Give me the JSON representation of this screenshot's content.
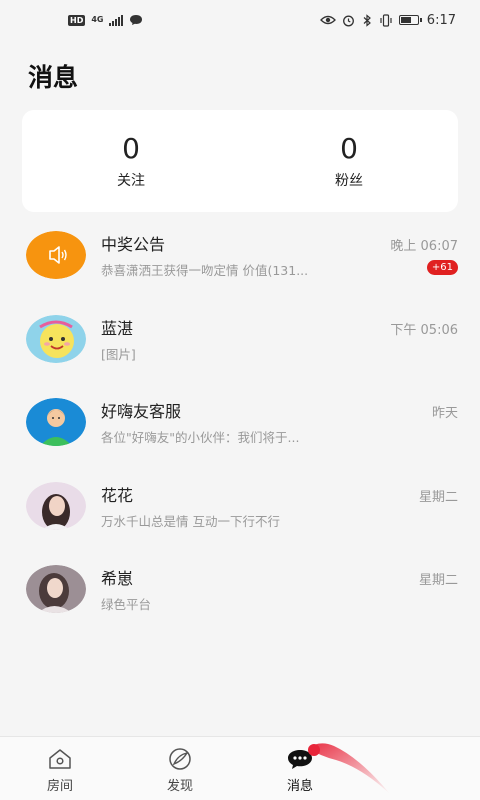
{
  "status_bar": {
    "hd": "HD",
    "network": "4G",
    "time": "6:17",
    "icons": [
      "hd-badge-icon",
      "signal-icon",
      "chat-bubble-icon",
      "eye-icon",
      "alarm-icon",
      "bluetooth-icon",
      "vibrate-icon",
      "battery-icon"
    ]
  },
  "header": {
    "title": "消息"
  },
  "stats": [
    {
      "value": "0",
      "label": "关注"
    },
    {
      "value": "0",
      "label": "粉丝"
    }
  ],
  "conversations": [
    {
      "name": "中奖公告",
      "preview": "恭喜潇洒王获得一吻定情 价值(131...",
      "time": "晚上 06:07",
      "badge": "+61",
      "avatar": "speaker-icon"
    },
    {
      "name": "蓝湛",
      "preview": "[图片]",
      "time": "下午 05:06",
      "avatar": "cartoon-avatar"
    },
    {
      "name": "好嗨友客服",
      "preview": "各位\"好嗨友\"的小伙伴：我们将于...",
      "time": "昨天",
      "avatar": "service-avatar"
    },
    {
      "name": "花花",
      "preview": "万水千山总是情 互动一下行不行",
      "time": "星期二",
      "avatar": "photo-avatar"
    },
    {
      "name": "希崽",
      "preview": "绿色平台",
      "time": "星期二",
      "avatar": "photo-avatar"
    }
  ],
  "bottom_nav": [
    {
      "label": "房间",
      "icon": "room-icon"
    },
    {
      "label": "发现",
      "icon": "discover-icon"
    },
    {
      "label": "消息",
      "icon": "message-icon",
      "active": true
    }
  ],
  "colors": {
    "background": "#f5f5f5",
    "accent_orange": "#f7940f",
    "badge_red": "#e02020",
    "muted_text": "#999999"
  }
}
